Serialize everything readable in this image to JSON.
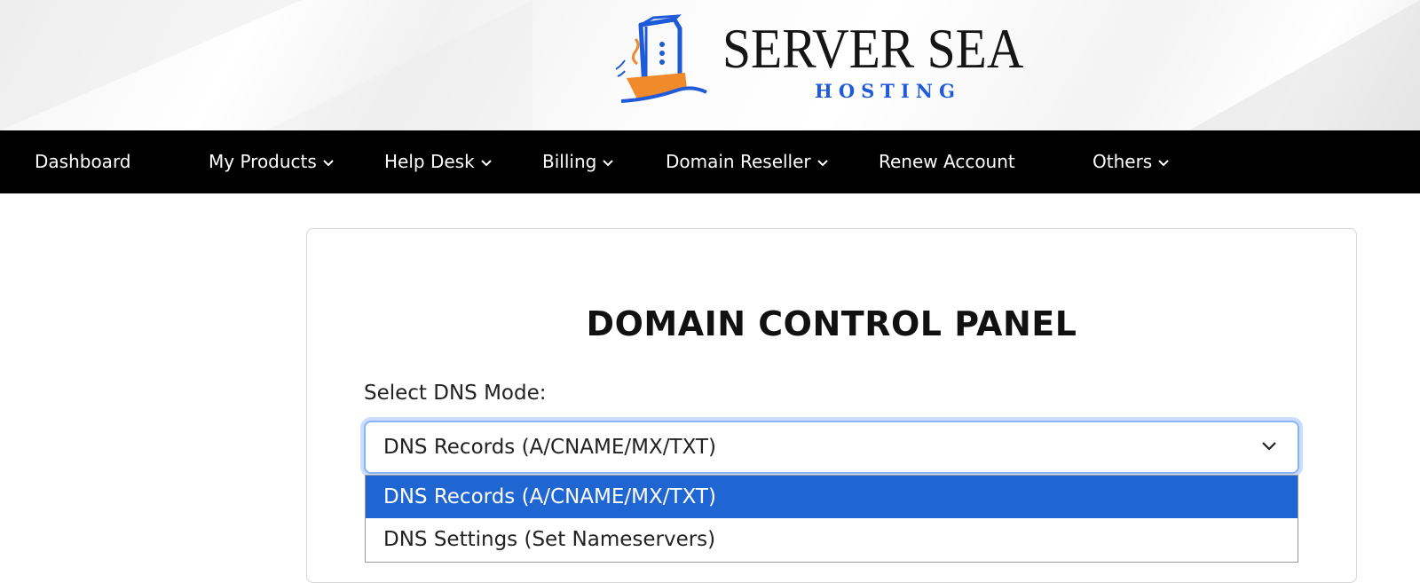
{
  "brand": {
    "name": "SERVER SEA",
    "subtitle": "HOSTING",
    "icon": "ship-server-icon",
    "colors": {
      "blue": "#1f5ad8",
      "orange": "#f08a2a",
      "dark": "#151515"
    }
  },
  "nav": {
    "items": [
      {
        "label": "Dashboard",
        "dropdown": false
      },
      {
        "label": "My Products",
        "dropdown": true
      },
      {
        "label": "Help Desk",
        "dropdown": true
      },
      {
        "label": "Billing",
        "dropdown": true
      },
      {
        "label": "Domain Reseller",
        "dropdown": true
      },
      {
        "label": "Renew Account",
        "dropdown": false
      },
      {
        "label": "Others",
        "dropdown": true
      }
    ],
    "chevron_icon": "chevron-down-icon"
  },
  "panel": {
    "title": "DOMAIN CONTROL PANEL",
    "dns_mode_label": "Select DNS Mode:",
    "dns_mode_value": "DNS Records (A/CNAME/MX/TXT)",
    "dns_mode_options": [
      "DNS Records (A/CNAME/MX/TXT)",
      "DNS Settings (Set Nameservers)"
    ],
    "selected_option_color": "#1f66d2"
  }
}
